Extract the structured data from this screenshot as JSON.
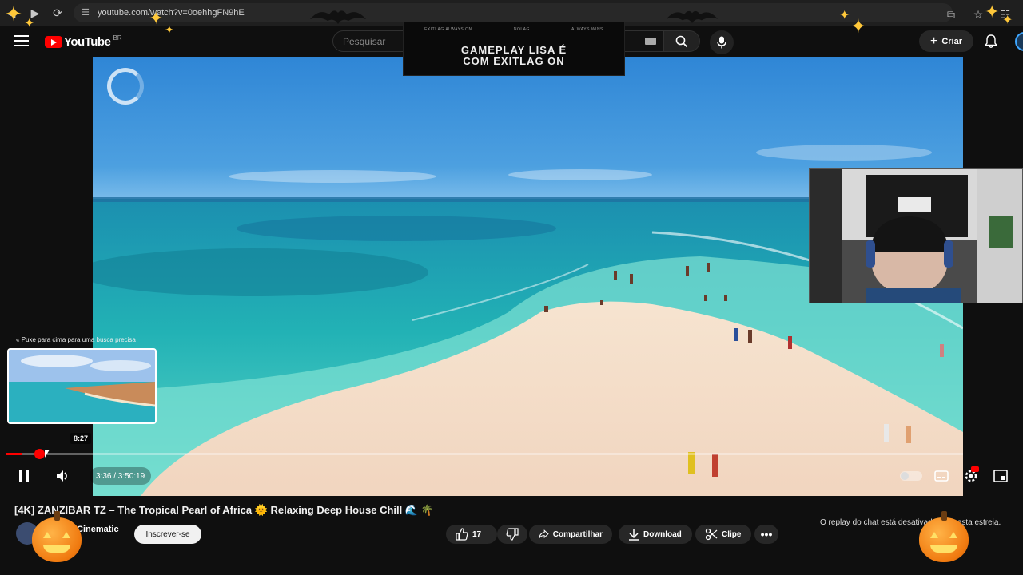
{
  "browser": {
    "url": "youtube.com/watch?v=0oehhgFN9hE"
  },
  "header": {
    "logo_text": "YouTube",
    "country": "BR",
    "search_placeholder": "Pesquisar",
    "create_label": "Criar"
  },
  "sponsor": {
    "top_items": [
      "EXITLAG ALWAYS ON",
      "NOLAG",
      "ALWAYS WINS"
    ],
    "title_line1": "GAMEPLAY LISA É",
    "title_line2": "COM EXITLAG ON"
  },
  "player": {
    "pull_hint": "Puxe para cima para uma busca precisa",
    "preview_time": "8:27",
    "time_display": "3:36 / 3:50:19",
    "progress_fraction": 0.016
  },
  "video": {
    "title": "[4K] ZANZIBAR TZ – The Tropical Pearl of Africa 🌞 Relaxing Deep House Chill 🌊 🌴",
    "channel_name": "Cinematic",
    "subscribe_label": "Inscrever-se",
    "like_count": "17",
    "share_label": "Compartilhar",
    "download_label": "Download",
    "clip_label": "Clipe"
  },
  "chat": {
    "replay_off_text": "O replay do chat está desativado para esta estreia."
  },
  "colors": {
    "accent_red": "#ff0000",
    "background": "#0f0f0f",
    "pumpkin": "#f07a10"
  }
}
